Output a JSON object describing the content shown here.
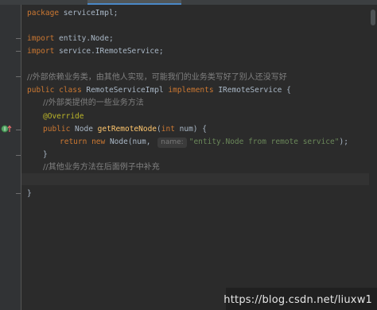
{
  "editor": {
    "lines": {
      "package": {
        "kw": "package",
        "rest": " serviceImpl;"
      },
      "import1": {
        "kw": "import",
        "rest": " entity.Node;"
      },
      "import2": {
        "kw": "import",
        "rest": " service.IRemoteService;"
      },
      "comment1": "//外部依赖业务类，由其他人实现，可能我们的业务类写好了别人还没写好",
      "class_decl": {
        "kw1": "public",
        "kw2": "class",
        "name": "RemoteServiceImpl",
        "kw3": "implements",
        "iface": "IRemoteService {"
      },
      "comment2": "//外部类提供的一些业务方法",
      "annotation": "@Override",
      "method_decl": {
        "kw1": "public",
        "type": " Node ",
        "name": "getRemoteNode",
        "params_open": "(",
        "kw_int": "int",
        "params_rest": " num) {"
      },
      "return_stmt": {
        "kw_return": "return",
        "kw_new": "new",
        "call": " Node(num, ",
        "hint": "name:",
        "string": "\"entity.Node from remote service\"",
        "end": ");"
      },
      "close_method": "}",
      "comment3": "//其他业务方法在后面例子中补充",
      "close_class": "}"
    }
  },
  "watermark": "https://blog.csdn.net/liuxw1"
}
